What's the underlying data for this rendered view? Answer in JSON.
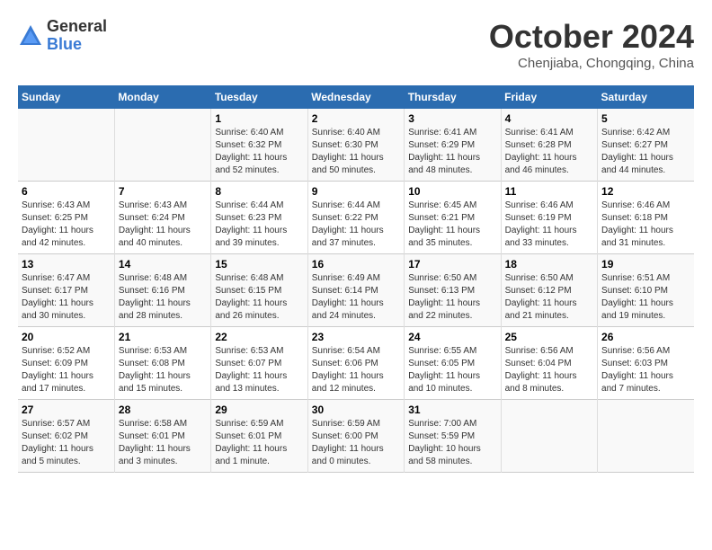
{
  "logo": {
    "general": "General",
    "blue": "Blue"
  },
  "title": "October 2024",
  "location": "Chenjiaba, Chongqing, China",
  "headers": [
    "Sunday",
    "Monday",
    "Tuesday",
    "Wednesday",
    "Thursday",
    "Friday",
    "Saturday"
  ],
  "weeks": [
    [
      {
        "day": "",
        "info": ""
      },
      {
        "day": "",
        "info": ""
      },
      {
        "day": "1",
        "info": "Sunrise: 6:40 AM\nSunset: 6:32 PM\nDaylight: 11 hours and 52 minutes."
      },
      {
        "day": "2",
        "info": "Sunrise: 6:40 AM\nSunset: 6:30 PM\nDaylight: 11 hours and 50 minutes."
      },
      {
        "day": "3",
        "info": "Sunrise: 6:41 AM\nSunset: 6:29 PM\nDaylight: 11 hours and 48 minutes."
      },
      {
        "day": "4",
        "info": "Sunrise: 6:41 AM\nSunset: 6:28 PM\nDaylight: 11 hours and 46 minutes."
      },
      {
        "day": "5",
        "info": "Sunrise: 6:42 AM\nSunset: 6:27 PM\nDaylight: 11 hours and 44 minutes."
      }
    ],
    [
      {
        "day": "6",
        "info": "Sunrise: 6:43 AM\nSunset: 6:25 PM\nDaylight: 11 hours and 42 minutes."
      },
      {
        "day": "7",
        "info": "Sunrise: 6:43 AM\nSunset: 6:24 PM\nDaylight: 11 hours and 40 minutes."
      },
      {
        "day": "8",
        "info": "Sunrise: 6:44 AM\nSunset: 6:23 PM\nDaylight: 11 hours and 39 minutes."
      },
      {
        "day": "9",
        "info": "Sunrise: 6:44 AM\nSunset: 6:22 PM\nDaylight: 11 hours and 37 minutes."
      },
      {
        "day": "10",
        "info": "Sunrise: 6:45 AM\nSunset: 6:21 PM\nDaylight: 11 hours and 35 minutes."
      },
      {
        "day": "11",
        "info": "Sunrise: 6:46 AM\nSunset: 6:19 PM\nDaylight: 11 hours and 33 minutes."
      },
      {
        "day": "12",
        "info": "Sunrise: 6:46 AM\nSunset: 6:18 PM\nDaylight: 11 hours and 31 minutes."
      }
    ],
    [
      {
        "day": "13",
        "info": "Sunrise: 6:47 AM\nSunset: 6:17 PM\nDaylight: 11 hours and 30 minutes."
      },
      {
        "day": "14",
        "info": "Sunrise: 6:48 AM\nSunset: 6:16 PM\nDaylight: 11 hours and 28 minutes."
      },
      {
        "day": "15",
        "info": "Sunrise: 6:48 AM\nSunset: 6:15 PM\nDaylight: 11 hours and 26 minutes."
      },
      {
        "day": "16",
        "info": "Sunrise: 6:49 AM\nSunset: 6:14 PM\nDaylight: 11 hours and 24 minutes."
      },
      {
        "day": "17",
        "info": "Sunrise: 6:50 AM\nSunset: 6:13 PM\nDaylight: 11 hours and 22 minutes."
      },
      {
        "day": "18",
        "info": "Sunrise: 6:50 AM\nSunset: 6:12 PM\nDaylight: 11 hours and 21 minutes."
      },
      {
        "day": "19",
        "info": "Sunrise: 6:51 AM\nSunset: 6:10 PM\nDaylight: 11 hours and 19 minutes."
      }
    ],
    [
      {
        "day": "20",
        "info": "Sunrise: 6:52 AM\nSunset: 6:09 PM\nDaylight: 11 hours and 17 minutes."
      },
      {
        "day": "21",
        "info": "Sunrise: 6:53 AM\nSunset: 6:08 PM\nDaylight: 11 hours and 15 minutes."
      },
      {
        "day": "22",
        "info": "Sunrise: 6:53 AM\nSunset: 6:07 PM\nDaylight: 11 hours and 13 minutes."
      },
      {
        "day": "23",
        "info": "Sunrise: 6:54 AM\nSunset: 6:06 PM\nDaylight: 11 hours and 12 minutes."
      },
      {
        "day": "24",
        "info": "Sunrise: 6:55 AM\nSunset: 6:05 PM\nDaylight: 11 hours and 10 minutes."
      },
      {
        "day": "25",
        "info": "Sunrise: 6:56 AM\nSunset: 6:04 PM\nDaylight: 11 hours and 8 minutes."
      },
      {
        "day": "26",
        "info": "Sunrise: 6:56 AM\nSunset: 6:03 PM\nDaylight: 11 hours and 7 minutes."
      }
    ],
    [
      {
        "day": "27",
        "info": "Sunrise: 6:57 AM\nSunset: 6:02 PM\nDaylight: 11 hours and 5 minutes."
      },
      {
        "day": "28",
        "info": "Sunrise: 6:58 AM\nSunset: 6:01 PM\nDaylight: 11 hours and 3 minutes."
      },
      {
        "day": "29",
        "info": "Sunrise: 6:59 AM\nSunset: 6:01 PM\nDaylight: 11 hours and 1 minute."
      },
      {
        "day": "30",
        "info": "Sunrise: 6:59 AM\nSunset: 6:00 PM\nDaylight: 11 hours and 0 minutes."
      },
      {
        "day": "31",
        "info": "Sunrise: 7:00 AM\nSunset: 5:59 PM\nDaylight: 10 hours and 58 minutes."
      },
      {
        "day": "",
        "info": ""
      },
      {
        "day": "",
        "info": ""
      }
    ]
  ]
}
